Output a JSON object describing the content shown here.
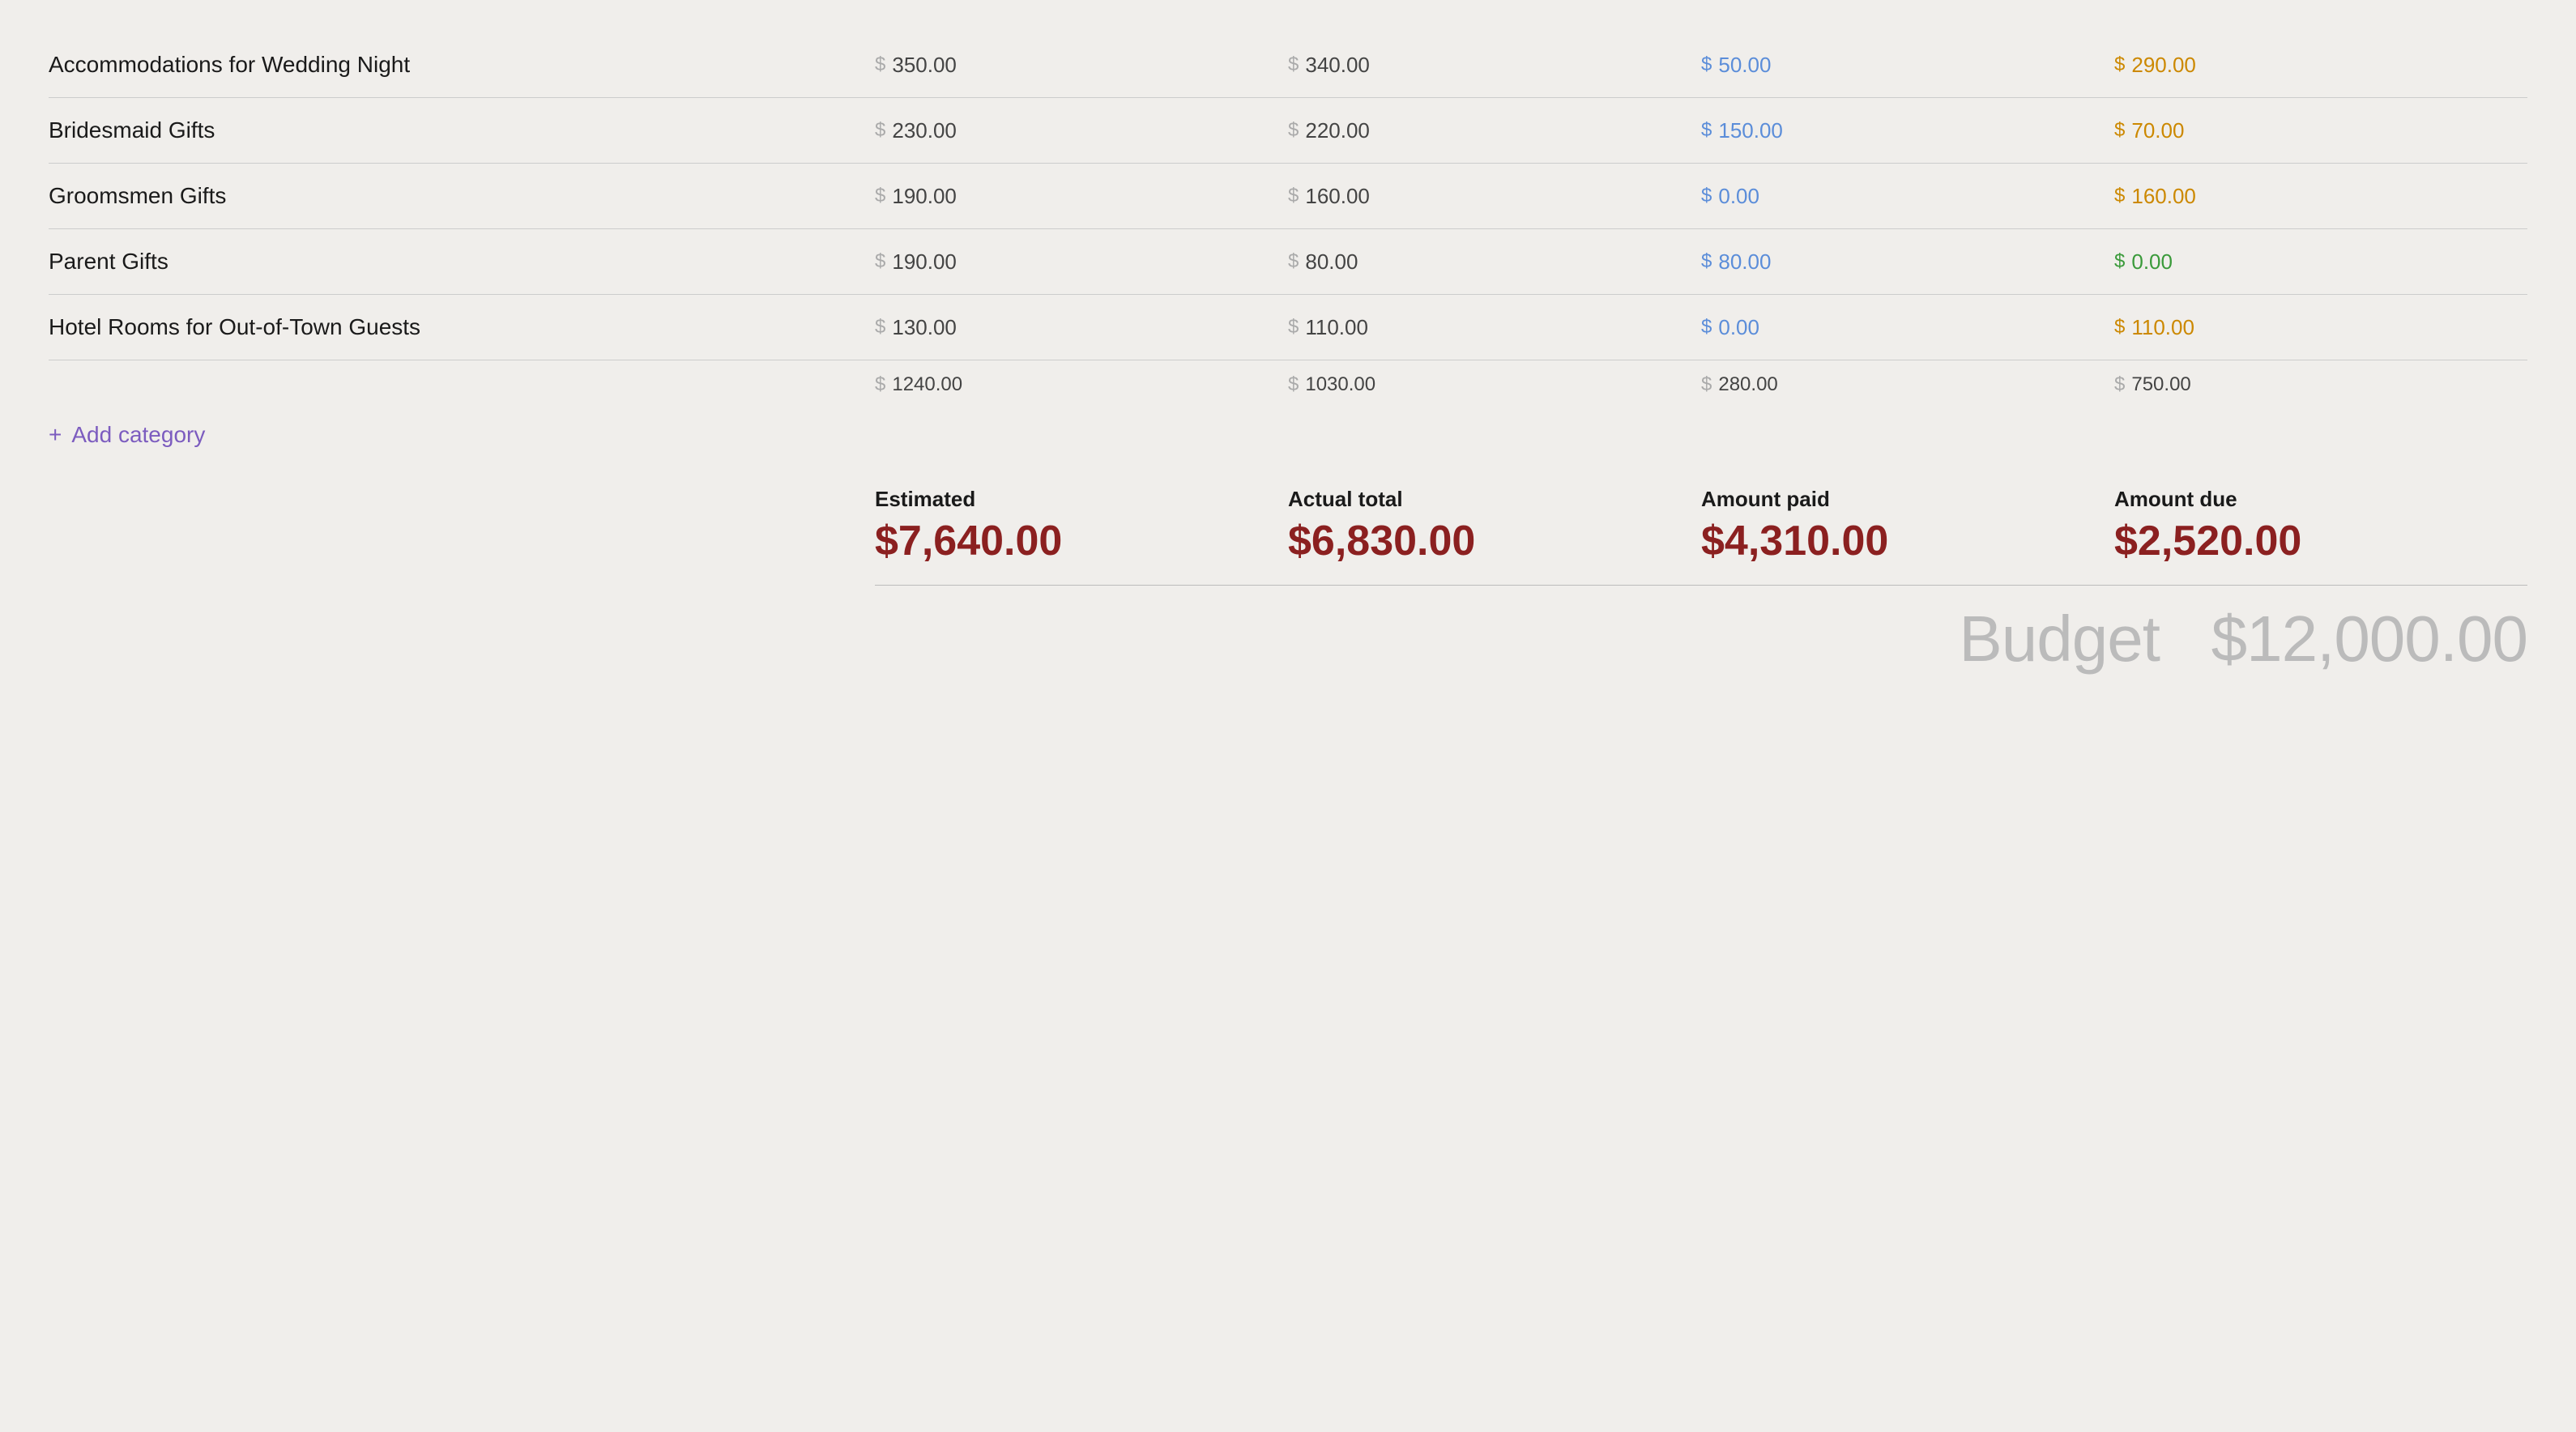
{
  "rows": [
    {
      "name": "Accommodations for Wedding Night",
      "estimated": "350.00",
      "actual": "340.00",
      "paid": "50.00",
      "due": "290.00",
      "due_color": "orange"
    },
    {
      "name": "Bridesmaid Gifts",
      "estimated": "230.00",
      "actual": "220.00",
      "paid": "150.00",
      "due": "70.00",
      "due_color": "orange"
    },
    {
      "name": "Groomsmen Gifts",
      "estimated": "190.00",
      "actual": "160.00",
      "paid": "0.00",
      "due": "160.00",
      "due_color": "orange"
    },
    {
      "name": "Parent Gifts",
      "estimated": "190.00",
      "actual": "80.00",
      "paid": "80.00",
      "due": "0.00",
      "due_color": "green"
    },
    {
      "name": "Hotel Rooms for Out-of-Town Guests",
      "estimated": "130.00",
      "actual": "110.00",
      "paid": "0.00",
      "due": "110.00",
      "due_color": "orange"
    }
  ],
  "section_totals": {
    "estimated": "1240.00",
    "actual": "1030.00",
    "paid": "280.00",
    "due": "750.00"
  },
  "add_category": {
    "icon": "+",
    "label": "Add category"
  },
  "summary": {
    "estimated_label": "Estimated",
    "estimated_value": "$7,640.00",
    "actual_label": "Actual total",
    "actual_value": "$6,830.00",
    "paid_label": "Amount paid",
    "paid_value": "$4,310.00",
    "due_label": "Amount due",
    "due_value": "$2,520.00"
  },
  "budget": {
    "label": "Budget",
    "value": "$12,000.00"
  }
}
